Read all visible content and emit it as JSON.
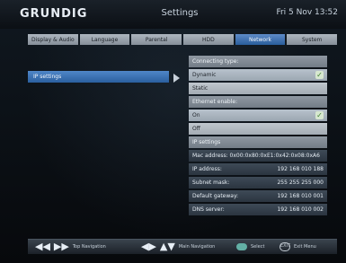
{
  "header": {
    "brand": "GRUNDIG",
    "title": "Settings",
    "datetime": "Fri 5 Nov 13:52"
  },
  "tabs": [
    {
      "label": "Display & Audio",
      "active": false
    },
    {
      "label": "Language",
      "active": false
    },
    {
      "label": "Parental",
      "active": false
    },
    {
      "label": "HDD",
      "active": false
    },
    {
      "label": "Network",
      "active": true
    },
    {
      "label": "System",
      "active": false
    }
  ],
  "left_menu": {
    "items": [
      {
        "label": "IP settings",
        "selected": true
      }
    ]
  },
  "right_panel": {
    "connecting_type": {
      "header": "Connecting type:",
      "options": [
        "Dynamic",
        "Static"
      ],
      "selected": "Dynamic"
    },
    "ethernet": {
      "header": "Ethernet enable:",
      "options": [
        "On",
        "Off"
      ],
      "selected": "On"
    },
    "ip_settings": {
      "header": "IP settings",
      "mac": "Mac address: 0x00:0x80:0xE1:0x42:0x08:0xA6",
      "ip_label": "IP address:",
      "ip_value": "192 168 010 188",
      "subnet_label": "Subnet mask:",
      "subnet_value": "255 255 255 000",
      "gateway_label": "Default gateway:",
      "gateway_value": "192 168 010 001",
      "dns_label": "DNS server:",
      "dns_value": "192 168 010 002"
    }
  },
  "footer": {
    "top_nav": "Top Navigation",
    "main_nav": "Main Navigation",
    "select": "Select",
    "exit": "Exit Menu",
    "exit_icon_text": "EXIT"
  },
  "icons": {
    "tick": "check-icon",
    "arrow": "right-arrow-icon",
    "rewind": "rewind-icon",
    "forward": "fast-forward-icon",
    "lr": "left-right-icon",
    "ud": "up-down-icon",
    "ok": "ok-button-icon",
    "exit": "exit-button-icon"
  },
  "colors": {
    "accent": "#3c6fae",
    "background": "#0b0f14"
  }
}
